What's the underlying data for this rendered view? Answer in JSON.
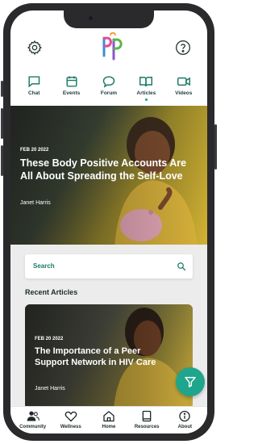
{
  "header": {
    "settings_icon": "gear-icon",
    "help_icon": "question-mark-icon",
    "logo_icon": "pp-logo"
  },
  "tabs": [
    {
      "label": "Chat",
      "icon": "chat-bubble-icon",
      "active": false
    },
    {
      "label": "Events",
      "icon": "calendar-icon",
      "active": false
    },
    {
      "label": "Forum",
      "icon": "forum-icon",
      "active": false
    },
    {
      "label": "Articles",
      "icon": "open-book-icon",
      "active": true
    },
    {
      "label": "Videos",
      "icon": "video-camera-icon",
      "active": false
    }
  ],
  "hero": {
    "date": "FEB 20 2022",
    "title": "These Body Positive Accounts Are All About Spreading the Self-Love",
    "author": "Janet Harris"
  },
  "search": {
    "placeholder": "Search"
  },
  "recent": {
    "heading": "Recent Articles",
    "cards": [
      {
        "date": "FEB 20 2022",
        "title": "The Importance of a Peer Support Network in HIV Care",
        "author": "Janet Harris"
      }
    ]
  },
  "bottom_nav": [
    {
      "label": "Community",
      "icon": "people-icon"
    },
    {
      "label": "Wellness",
      "icon": "heart-icon"
    },
    {
      "label": "Home",
      "icon": "home-icon"
    },
    {
      "label": "Resources",
      "icon": "book-icon"
    },
    {
      "label": "About",
      "icon": "info-icon"
    }
  ],
  "colors": {
    "accent": "#1fa58c",
    "tab_icon": "#1a7a66",
    "text_dark": "#1f2a2a"
  }
}
